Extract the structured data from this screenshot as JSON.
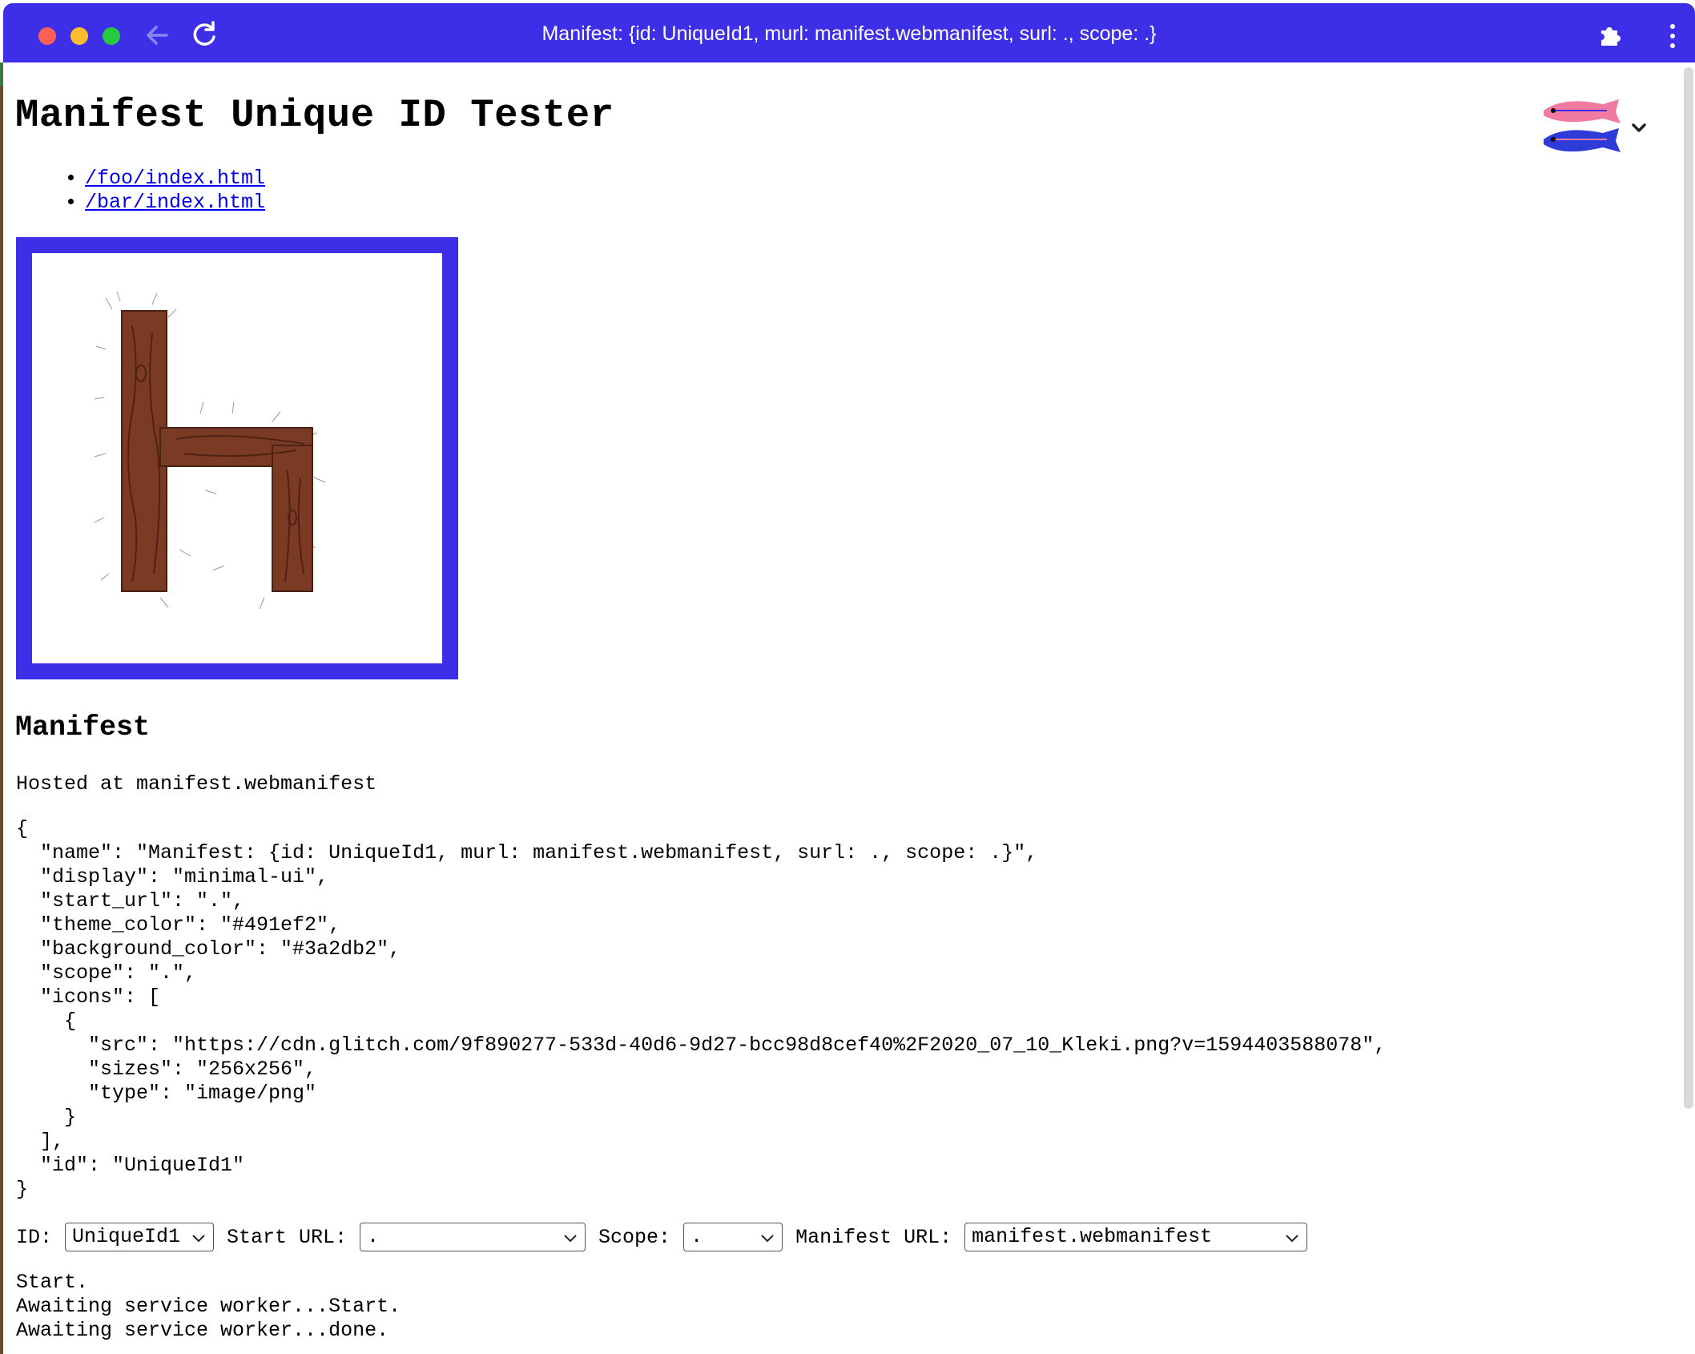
{
  "window": {
    "title": "Manifest: {id: UniqueId1, murl: manifest.webmanifest, surl: ., scope: .}",
    "accent": "#3d2fe8"
  },
  "page": {
    "heading": "Manifest Unique ID Tester",
    "links": [
      "/foo/index.html",
      "/bar/index.html"
    ],
    "manifest_heading": "Manifest",
    "hosted_text": "Hosted at manifest.webmanifest",
    "manifest_json_lines": [
      "{",
      "  \"name\": \"Manifest: {id: UniqueId1, murl: manifest.webmanifest, surl: ., scope: .}\",",
      "  \"display\": \"minimal-ui\",",
      "  \"start_url\": \".\",",
      "  \"theme_color\": \"#491ef2\",",
      "  \"background_color\": \"#3a2db2\",",
      "  \"scope\": \".\",",
      "  \"icons\": [",
      "    {",
      "      \"src\": \"https://cdn.glitch.com/9f890277-533d-40d6-9d27-bcc98d8cef40%2F2020_07_10_Kleki.png?v=1594403588078\",",
      "      \"sizes\": \"256x256\",",
      "      \"type\": \"image/png\"",
      "    }",
      "  ],",
      "  \"id\": \"UniqueId1\"",
      "}"
    ]
  },
  "controls": {
    "id_label": "ID:",
    "id_value": "UniqueId1",
    "start_url_label": "Start URL:",
    "start_url_value": ".",
    "scope_label": "Scope:",
    "scope_value": ".",
    "manifest_url_label": "Manifest URL:",
    "manifest_url_value": "manifest.webmanifest"
  },
  "log": [
    "Start.",
    "Awaiting service worker...Start.",
    "Awaiting service worker...done."
  ],
  "icons": {
    "back": "arrow-left-icon",
    "reload": "reload-icon",
    "extensions": "puzzle-icon",
    "menu": "kebab-menu-icon",
    "profile": "fish-avatar-icon",
    "app_icon": "wooden-letter-h-icon"
  }
}
